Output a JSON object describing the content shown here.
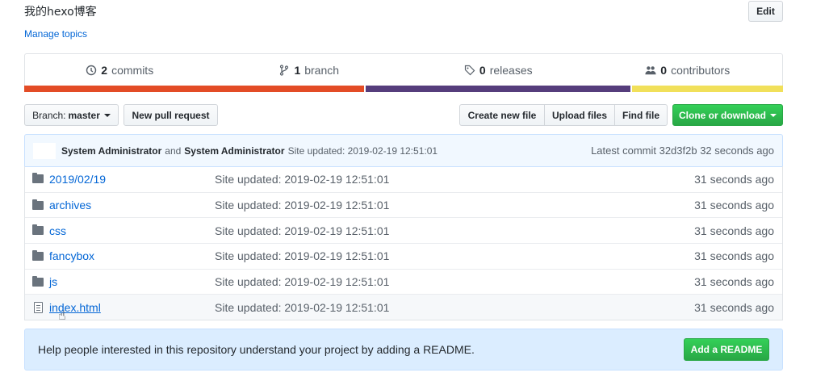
{
  "repo": {
    "description": "我的hexo博客",
    "manage_topics": "Manage topics",
    "edit_label": "Edit"
  },
  "summary": {
    "commits_count": "2",
    "commits_label": "commits",
    "branch_count": "1",
    "branch_label": "branch",
    "releases_count": "0",
    "releases_label": "releases",
    "contributors_count": "0",
    "contributors_label": "contributors"
  },
  "language_bar": [
    {
      "color": "#e34c26",
      "fraction": 0.45
    },
    {
      "color": "#563d7c",
      "fraction": 0.35
    },
    {
      "color": "#f1e05a",
      "fraction": 0.2
    }
  ],
  "toolbar": {
    "branch_prefix": "Branch:",
    "branch_name": "master",
    "new_pr": "New pull request",
    "create_file": "Create new file",
    "upload_files": "Upload files",
    "find_file": "Find file",
    "clone": "Clone or download"
  },
  "commit": {
    "author": "System Administrator",
    "joiner": "and",
    "committer": "System Administrator",
    "message": "Site updated: 2019-02-19 12:51:01",
    "latest_label": "Latest commit 32d3f2b 32 seconds ago"
  },
  "files": [
    {
      "name": "2019/02/19",
      "type": "folder",
      "message": "Site updated: 2019-02-19 12:51:01",
      "age": "31 seconds ago"
    },
    {
      "name": "archives",
      "type": "folder",
      "message": "Site updated: 2019-02-19 12:51:01",
      "age": "31 seconds ago"
    },
    {
      "name": "css",
      "type": "folder",
      "message": "Site updated: 2019-02-19 12:51:01",
      "age": "31 seconds ago"
    },
    {
      "name": "fancybox",
      "type": "folder",
      "message": "Site updated: 2019-02-19 12:51:01",
      "age": "31 seconds ago"
    },
    {
      "name": "js",
      "type": "folder",
      "message": "Site updated: 2019-02-19 12:51:01",
      "age": "31 seconds ago"
    },
    {
      "name": "index.html",
      "type": "file",
      "message": "Site updated: 2019-02-19 12:51:01",
      "age": "31 seconds ago"
    }
  ],
  "readme_prompt": {
    "text": "Help people interested in this repository understand your project by adding a README.",
    "button": "Add a README"
  },
  "colors": {
    "link": "#0366d6",
    "primary_button": "#28a745"
  }
}
